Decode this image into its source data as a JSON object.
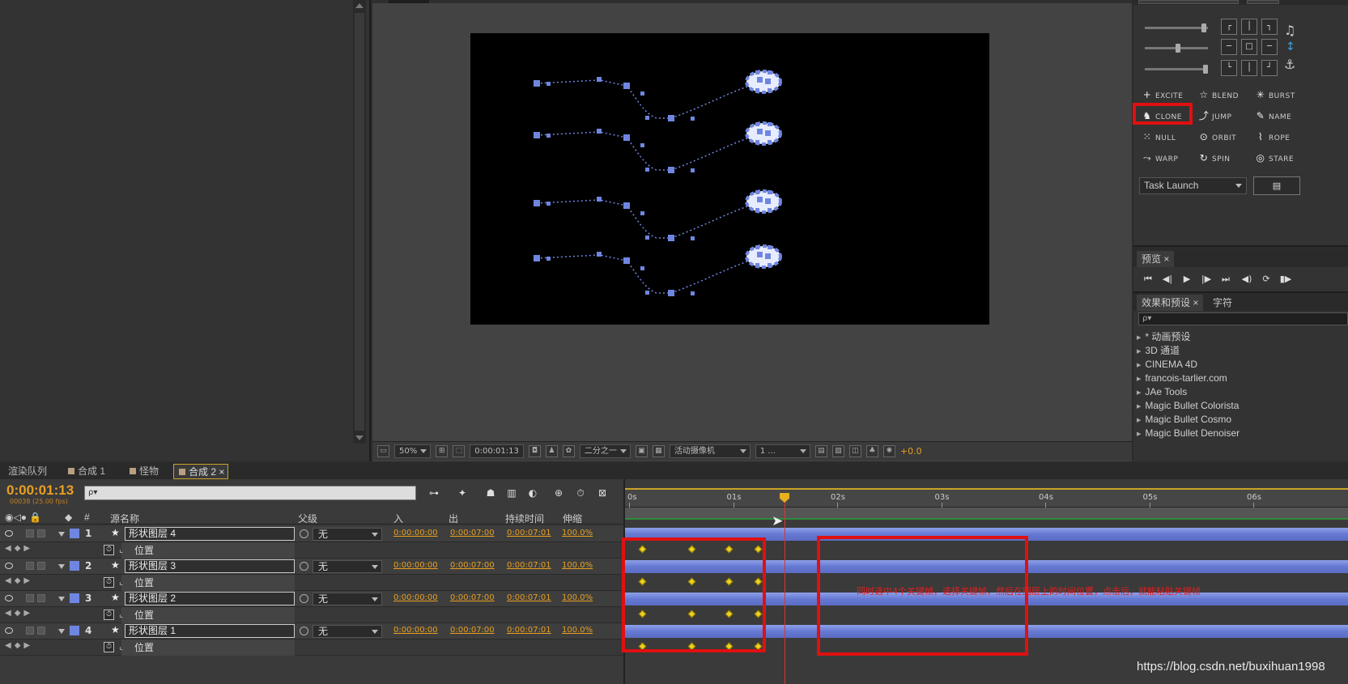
{
  "viewer": {
    "zoom": "50%",
    "timecode": "0:00:01:13",
    "resolution": "二分之一",
    "camera": "活动摄像机",
    "views": "1 ...",
    "exposure": "+0.0"
  },
  "motion": {
    "buttons": [
      {
        "label": "EXCITE",
        "icon": "plus-icon"
      },
      {
        "label": "BLEND",
        "icon": "blend-icon"
      },
      {
        "label": "BURST",
        "icon": "burst-icon"
      },
      {
        "label": "CLONE",
        "icon": "clone-icon"
      },
      {
        "label": "JUMP",
        "icon": "jump-icon"
      },
      {
        "label": "NAME",
        "icon": "pencil-icon"
      },
      {
        "label": "NULL",
        "icon": "null-icon"
      },
      {
        "label": "ORBIT",
        "icon": "orbit-icon"
      },
      {
        "label": "ROPE",
        "icon": "rope-icon"
      },
      {
        "label": "WARP",
        "icon": "warp-icon"
      },
      {
        "label": "SPIN",
        "icon": "spin-icon"
      },
      {
        "label": "STARE",
        "icon": "eye-icon"
      }
    ],
    "task_launch": "Task Launch"
  },
  "preview": {
    "tab": "预览 ×"
  },
  "effects": {
    "tabs": [
      "效果和预设 ×",
      "字符"
    ],
    "search_placeholder": "ρ▾",
    "items": [
      "* 动画预设",
      "3D 通道",
      "CINEMA 4D",
      "francois-tarlier.com",
      "JAe Tools",
      "Magic Bullet Colorista",
      "Magic Bullet Cosmo",
      "Magic Bullet Denoiser"
    ]
  },
  "timeline": {
    "tabs": [
      "渲染队列",
      "合成 1",
      "怪物",
      "合成 2 ×"
    ],
    "current_time": "0:00:01:13",
    "fps": "00038 (25.00 fps)",
    "search_placeholder": "ρ▾",
    "columns": {
      "num": "#",
      "source": "源名称",
      "parent": "父级",
      "in": "入",
      "out": "出",
      "duration": "持续时间",
      "stretch": "伸缩"
    },
    "layers": [
      {
        "num": "1",
        "name": "形状图层 4",
        "parent": "无",
        "in": "0:00:00:00",
        "out": "0:00:07:00",
        "duration": "0:00:07:01",
        "stretch": "100.0%",
        "prop": "位置"
      },
      {
        "num": "2",
        "name": "形状图层 3",
        "parent": "无",
        "in": "0:00:00:00",
        "out": "0:00:07:00",
        "duration": "0:00:07:01",
        "stretch": "100.0%",
        "prop": "位置"
      },
      {
        "num": "3",
        "name": "形状图层 2",
        "parent": "无",
        "in": "0:00:00:00",
        "out": "0:00:07:00",
        "duration": "0:00:07:01",
        "stretch": "100.0%",
        "prop": "位置"
      },
      {
        "num": "4",
        "name": "形状图层 1",
        "parent": "无",
        "in": "0:00:00:00",
        "out": "0:00:07:00",
        "duration": "0:00:07:01",
        "stretch": "100.0%",
        "prop": "位置"
      }
    ],
    "ruler": [
      "0s",
      "01s",
      "02s",
      "03s",
      "04s",
      "05s",
      "06s"
    ]
  },
  "annotation": "同时选中4个关键帧，选择关键帧，然后在图层上的时间位置，点击后，就能粘贴关键帧",
  "watermark": "https://blog.csdn.net/buxihuan1998",
  "colors": {
    "accent": "#e8a020",
    "highlight": "#e01010",
    "layer": "#6f86e0",
    "keyframe": "#f0d020"
  }
}
